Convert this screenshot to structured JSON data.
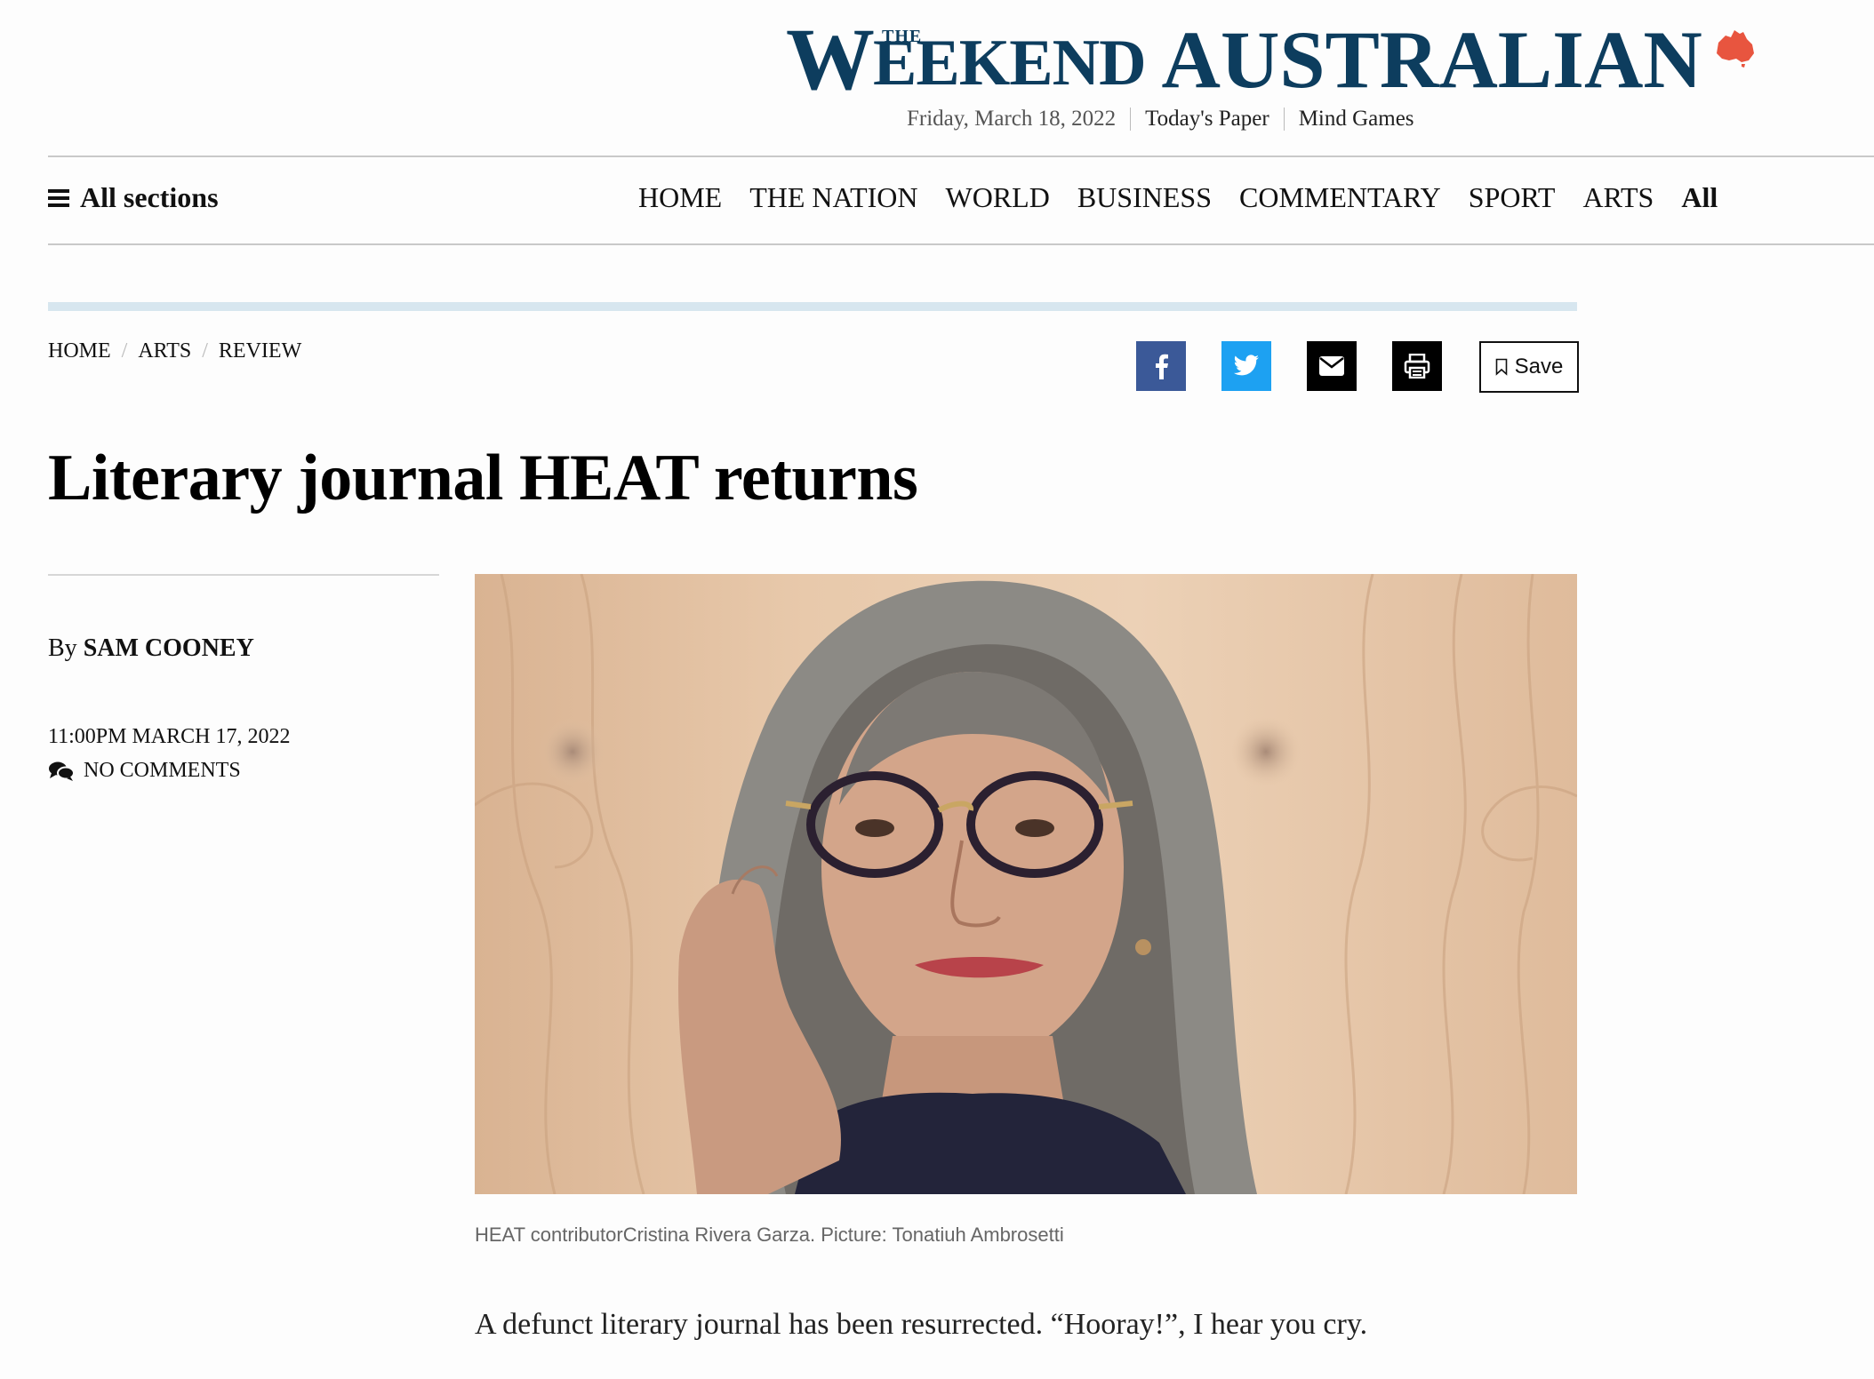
{
  "masthead": {
    "logo_the": "THE",
    "logo_w": "W",
    "logo_eekend": "EEKEND",
    "logo_australian": "AUSTRALIAN",
    "logo_color": "#0d3d5e",
    "logo_map_color": "#e8553f",
    "date": "Friday, March 18, 2022",
    "links": [
      "Today's Paper",
      "Mind Games"
    ]
  },
  "nav": {
    "all_sections": "All sections",
    "items": [
      "HOME",
      "THE NATION",
      "WORLD",
      "BUSINESS",
      "COMMENTARY",
      "SPORT",
      "ARTS",
      "All"
    ]
  },
  "breadcrumb": [
    "HOME",
    "ARTS",
    "REVIEW"
  ],
  "share": {
    "icons": [
      "facebook-icon",
      "twitter-icon",
      "email-icon",
      "print-icon"
    ],
    "colors": {
      "facebook": "#3b5998",
      "twitter": "#1da1f2",
      "email": "#000000",
      "print": "#000000"
    },
    "save_label": "Save"
  },
  "article": {
    "headline": "Literary journal HEAT returns",
    "by_prefix": "By",
    "author": "SAM COONEY",
    "timestamp": "11:00PM MARCH 17, 2022",
    "comments": "NO COMMENTS",
    "caption": "HEAT contributorCristina Rivera Garza. Picture: Tonatiuh Ambrosetti",
    "lede": "A defunct literary journal has been resurrected. “Hooray!”, I hear you cry."
  },
  "theme": {
    "accent_bar": "#d7e6ef"
  }
}
